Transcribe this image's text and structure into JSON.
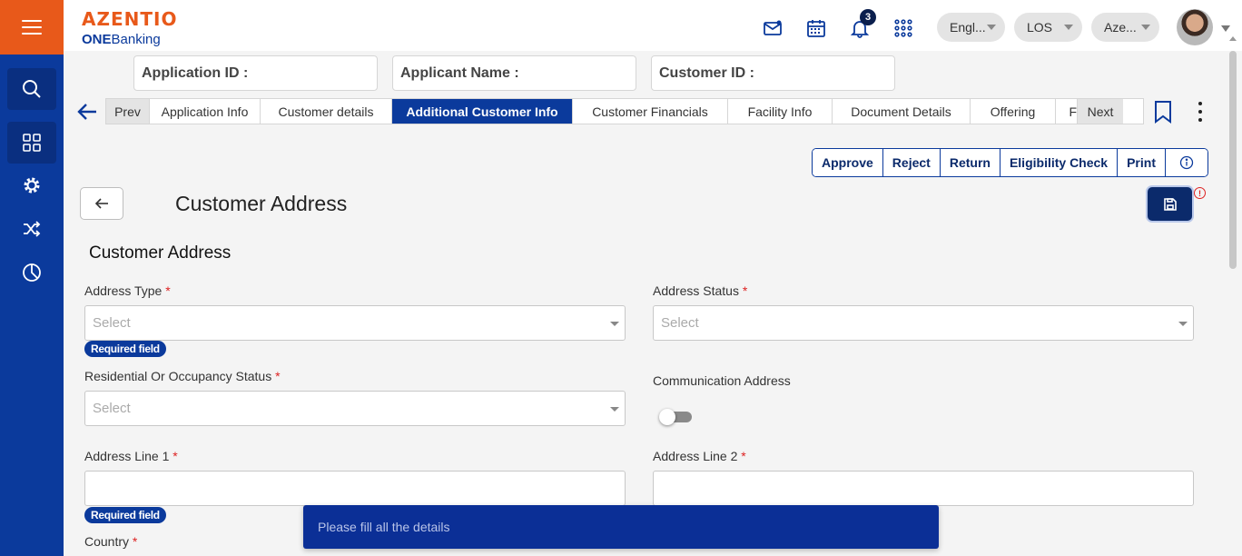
{
  "brand": {
    "name": "AZENTIO",
    "product_prefix": "ONE",
    "product_suffix": "Banking",
    "accent": "#e8591a",
    "primary": "#0b3a9c"
  },
  "header": {
    "notification_count": "3",
    "language": "Engl...",
    "module": "LOS",
    "entity": "Aze...",
    "icons": [
      "mail-icon",
      "calendar-icon",
      "bell-icon",
      "apps-grid-icon"
    ]
  },
  "sidebar": {
    "items": [
      "search-icon",
      "dashboard-icon",
      "settings-icon",
      "shuffle-icon",
      "pie-chart-icon"
    ]
  },
  "ids": {
    "application_id": "Application ID :",
    "applicant_name": "Applicant Name :",
    "customer_id": "Customer ID :"
  },
  "tabs": {
    "prev": "Prev",
    "next": "Next",
    "items": [
      {
        "label": "Application Info"
      },
      {
        "label": "Customer details"
      },
      {
        "label": "Additional Customer Info"
      },
      {
        "label": "Customer Financials"
      },
      {
        "label": "Facility Info"
      },
      {
        "label": "Document Details"
      },
      {
        "label": "Offering"
      },
      {
        "label": "F"
      }
    ],
    "active": "Additional Customer Info"
  },
  "actions": {
    "approve": "Approve",
    "reject": "Reject",
    "return": "Return",
    "eligibility": "Eligibility Check",
    "print": "Print"
  },
  "page": {
    "title": "Customer Address",
    "section_title": "Customer Address"
  },
  "form": {
    "required_mark": "*",
    "required_badge": "Required field",
    "select_placeholder": "Select",
    "address_type": "Address Type",
    "address_status": "Address Status",
    "residential_status": "Residential Or Occupancy Status",
    "communication_address": "Communication Address",
    "communication_address_on": false,
    "address_line1": "Address Line 1",
    "address_line2": "Address Line 2",
    "country": "Country"
  },
  "toast": {
    "message": "Please fill all the details"
  }
}
